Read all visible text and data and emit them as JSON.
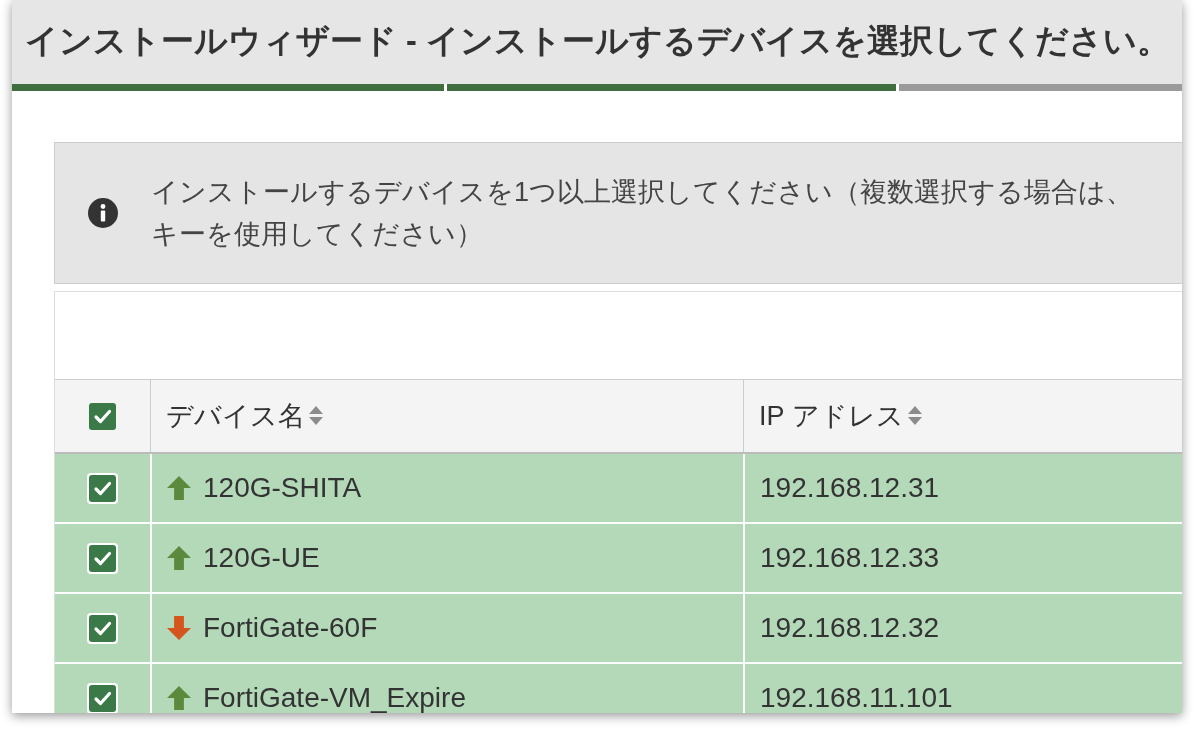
{
  "window": {
    "title": "インストールウィザード - インストールするデバイスを選択してください。"
  },
  "wizard_steps": [
    {
      "completed": true
    },
    {
      "completed": true
    },
    {
      "completed": false
    }
  ],
  "info": {
    "message_lines": [
      "インストールするデバイスを1つ以上選択してください（複数選択する場合は、",
      "キーを使用してください）"
    ]
  },
  "table": {
    "select_all": {
      "checked": true
    },
    "columns": [
      {
        "label": "デバイス名",
        "sortable": true
      },
      {
        "label": "IP アドレス",
        "sortable": true
      }
    ],
    "rows": [
      {
        "selected": true,
        "checked": true,
        "kind": "up",
        "name": "120G-SHITA",
        "ip": "192.168.12.31"
      },
      {
        "selected": true,
        "checked": true,
        "kind": "up",
        "name": "120G-UE",
        "ip": "192.168.12.33"
      },
      {
        "selected": true,
        "checked": true,
        "kind": "down",
        "name": "FortiGate-60F",
        "ip": "192.168.12.32"
      },
      {
        "selected": true,
        "checked": true,
        "kind": "up",
        "name": "FortiGate-VM_Expire",
        "ip": "192.168.11.101"
      }
    ]
  }
}
